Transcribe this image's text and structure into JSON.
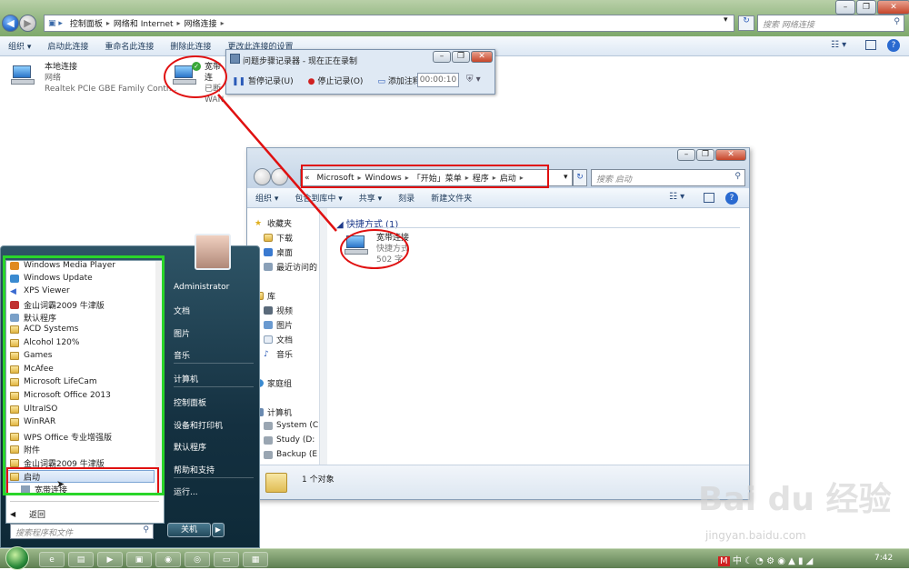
{
  "main_window": {
    "breadcrumb": [
      "控制面板",
      "网络和 Internet",
      "网络连接"
    ],
    "search_placeholder": "搜索 网络连接",
    "toolbar": [
      "组织 ▾",
      "启动此连接",
      "重命名此连接",
      "删除此连接",
      "更改此连接的设置"
    ],
    "connections": [
      {
        "name": "本地连接",
        "line2": "网络",
        "line3": "Realtek PCIe GBE Family Contr..."
      },
      {
        "name": "宽带连",
        "line2": "已断",
        "line3": "WAN"
      }
    ]
  },
  "psr": {
    "title": "问题步骤记录器 - 现在正在录制",
    "pause": "暂停记录(U)",
    "stop": "停止记录(O)",
    "comment": "添加注释(A)",
    "timer": "00:00:10"
  },
  "explorer": {
    "breadcrumb": [
      "«",
      "Microsoft",
      "Windows",
      "「开始」菜单",
      "程序",
      "启动"
    ],
    "search_placeholder": "搜索 启动",
    "toolbar": [
      "组织 ▾",
      "包含到库中 ▾",
      "共享 ▾",
      "刻录",
      "新建文件夹"
    ],
    "nav": {
      "favorites": "收藏夹",
      "downloads": "下载",
      "desktop": "桌面",
      "recent": "最近访问的",
      "libraries": "库",
      "videos": "视频",
      "pictures": "图片",
      "documents": "文档",
      "music": "音乐",
      "homegroup": "家庭组",
      "computer": "计算机",
      "system": "System (C",
      "study": "Study (D:",
      "backup": "Backup (E"
    },
    "group_title": "快捷方式 (1)",
    "item": {
      "name": "宽带连接",
      "type": "快捷方式",
      "size": "502 字"
    },
    "status": "1 个对象"
  },
  "start_menu": {
    "programs": [
      "Windows Media Player",
      "Windows Update",
      "XPS Viewer",
      "金山词霸2009 牛津版",
      "默认程序",
      "ACD Systems",
      "Alcohol 120%",
      "Games",
      "McAfee",
      "Microsoft LifeCam",
      "Microsoft Office 2013",
      "UltraISO",
      "WinRAR",
      "WPS Office 专业增强版",
      "附件",
      "金山词霸2009 牛津版",
      "启动",
      "宽带连接"
    ],
    "back": "返回",
    "search_placeholder": "搜索程序和文件",
    "right": [
      "Administrator",
      "文档",
      "图片",
      "音乐",
      "计算机",
      "控制面板",
      "设备和打印机",
      "默认程序",
      "帮助和支持",
      "运行..."
    ],
    "shutdown": "关机"
  },
  "taskbar": {
    "time": "7:42",
    "lang": "中"
  },
  "watermark": {
    "brand": "Bai du 经验",
    "url": "jingyan.baidu.com"
  }
}
